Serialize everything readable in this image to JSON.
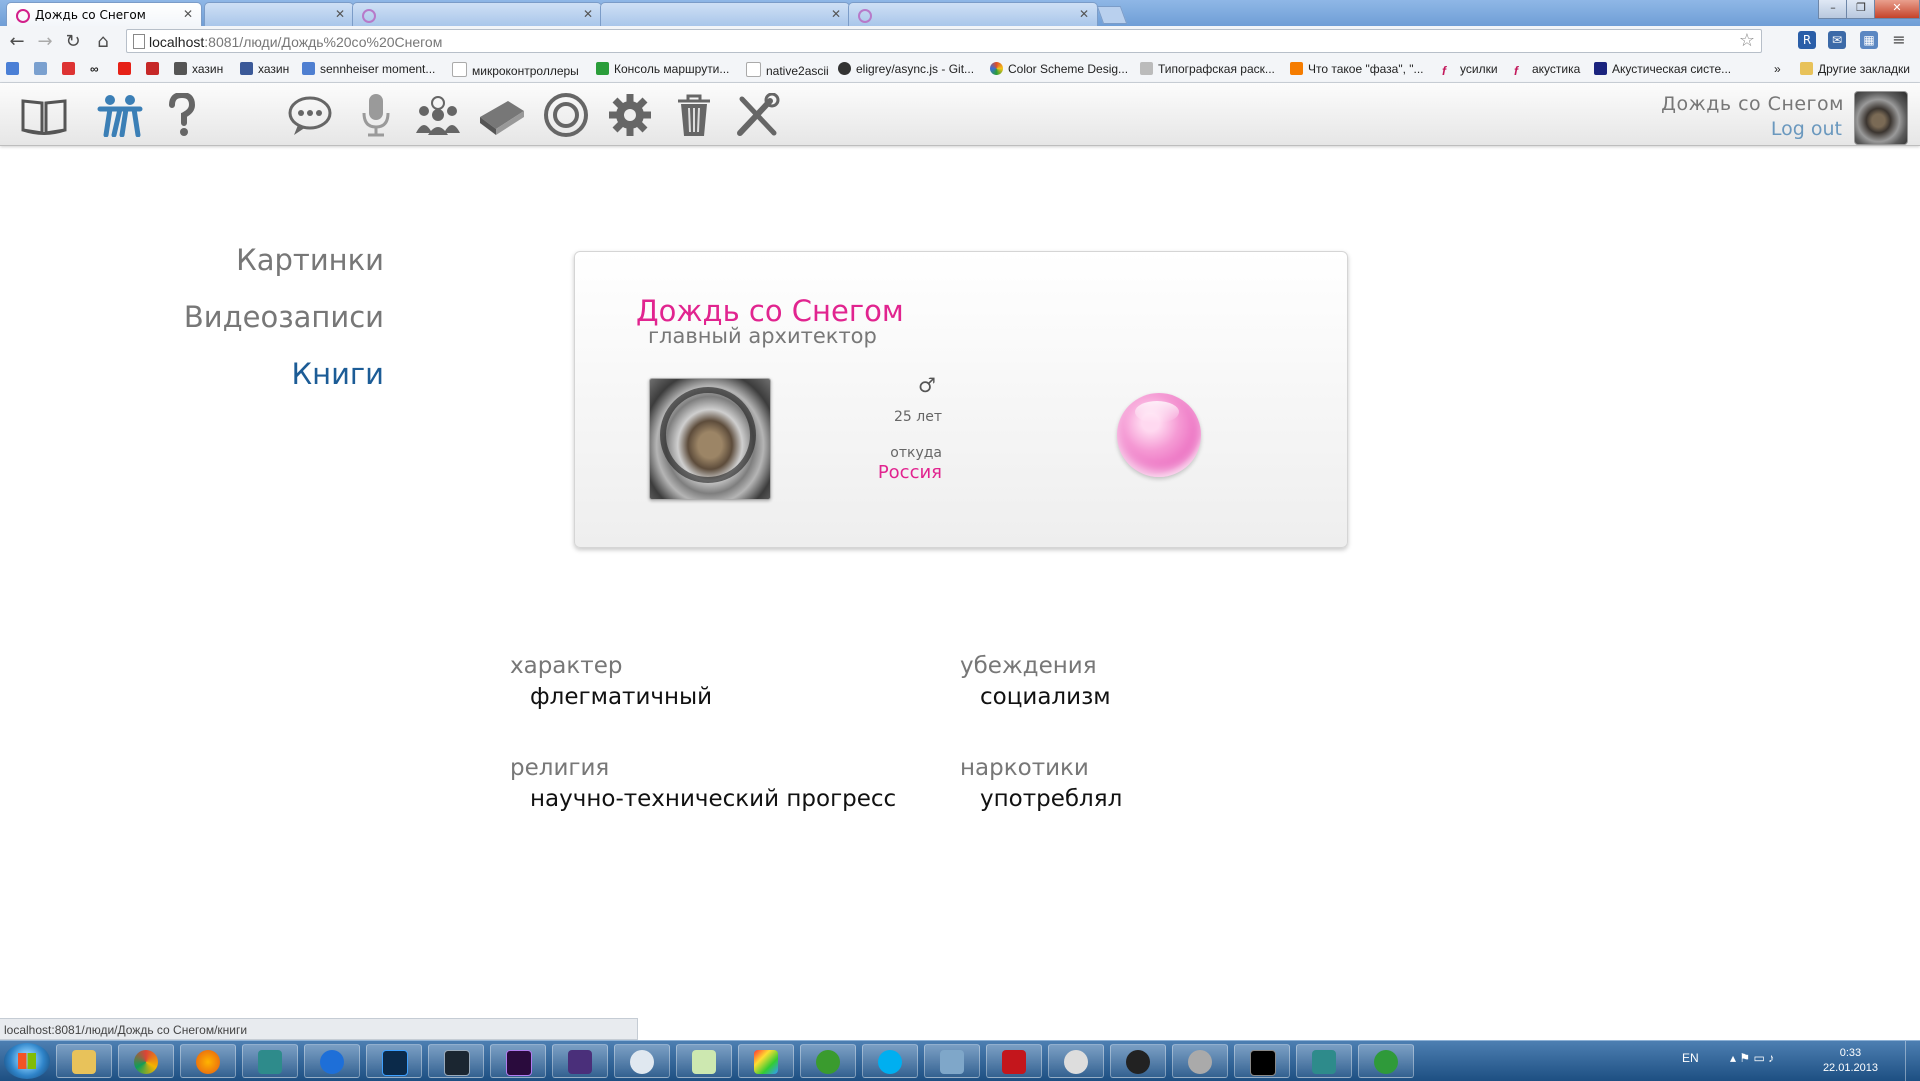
{
  "browser": {
    "tabs": [
      {
        "label": "Дождь со Снегом",
        "active": true
      },
      {
        "label": "",
        "active": false
      },
      {
        "label": "",
        "active": false
      },
      {
        "label": "",
        "active": false
      },
      {
        "label": "",
        "active": false
      }
    ],
    "url_host": "localhost",
    "url_rest": ":8081/люди/Дождь%20со%20Снегом",
    "bookmarks": [
      {
        "label": "хазин",
        "icon_color": "#555555"
      },
      {
        "label": "хазин",
        "icon_color": "#3b5998"
      },
      {
        "label": "sennheiser moment...",
        "icon_color": "#4f7fd1"
      },
      {
        "label": "микроконтроллеры",
        "icon_color": "#cccccc"
      },
      {
        "label": "Консоль маршрути...",
        "icon_color": "#2a9d3a"
      },
      {
        "label": "native2ascii",
        "icon_color": "#cccccc"
      },
      {
        "label": "eligrey/async.js - Git...",
        "icon_color": "#333333"
      },
      {
        "label": "Color Scheme Desig...",
        "icon_color": "#e04e2a"
      },
      {
        "label": "Типографская раск...",
        "icon_color": "#bbbbbb"
      },
      {
        "label": "Что такое \"фаза\", \"...",
        "icon_color": "#f57c00"
      },
      {
        "label": "усилки",
        "icon_color": "#c2185b"
      },
      {
        "label": "акустика",
        "icon_color": "#c2185b"
      },
      {
        "label": "Акустическая систе...",
        "icon_color": "#1a237e"
      }
    ],
    "other_bookmarks": "Другие закладки",
    "status_url": "localhost:8081/люди/Дождь со Снегом/книги"
  },
  "header": {
    "icons": [
      "book-icon",
      "people-icon",
      "help-icon",
      "chat-icon",
      "microphone-icon",
      "community-icon",
      "library-icon",
      "target-icon",
      "settings-gear-icon",
      "trash-icon",
      "tools-icon"
    ],
    "user_name": "Дождь со Снегом",
    "logout_label": "Log out"
  },
  "sidenav": {
    "items": [
      {
        "label": "Картинки",
        "active": false
      },
      {
        "label": "Видеозаписи",
        "active": false
      },
      {
        "label": "Книги",
        "active": true
      }
    ]
  },
  "profile": {
    "name": "Дождь со Снегом",
    "role": "главный архитектор",
    "gender_symbol": "♂",
    "age": "25 лет",
    "from_label": "откуда",
    "from_value": "Россия",
    "accent_color": "#e1248f"
  },
  "attributes": [
    {
      "label": "характер",
      "value": "флегматичный"
    },
    {
      "label": "убеждения",
      "value": "социализм"
    },
    {
      "label": "религия",
      "value": "научно-технический прогресс"
    },
    {
      "label": "наркотики",
      "value": "употреблял"
    }
  ],
  "taskbar": {
    "language": "EN",
    "time": "0:33",
    "date": "22.01.2013"
  }
}
